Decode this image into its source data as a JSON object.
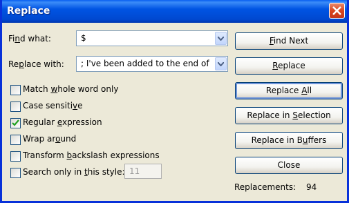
{
  "window": {
    "title": "Replace"
  },
  "find": {
    "label_pre": "Fi",
    "label_u": "n",
    "label_post": "d what:",
    "value": "$"
  },
  "replace": {
    "label_pre": "Re",
    "label_u": "p",
    "label_post": "lace with:",
    "value": "; I've been added to the end of every line"
  },
  "options": [
    {
      "pre": "Match ",
      "u": "w",
      "post": "hole word only",
      "checked": false
    },
    {
      "pre": "Case sensiti",
      "u": "v",
      "post": "e",
      "checked": false
    },
    {
      "pre": "Regular ",
      "u": "e",
      "post": "xpression",
      "checked": true
    },
    {
      "pre": "Wrap ar",
      "u": "o",
      "post": "und",
      "checked": false
    },
    {
      "pre": "Transform ",
      "u": "b",
      "post": "ackslash expressions",
      "checked": false
    },
    {
      "pre": "Search only in ",
      "u": "t",
      "post": "his style:",
      "checked": false
    }
  ],
  "style_value": "11",
  "buttons": {
    "find_next": {
      "pre": "",
      "u": "F",
      "post": "ind Next"
    },
    "replace": {
      "pre": "",
      "u": "R",
      "post": "eplace"
    },
    "replace_all": {
      "pre": "Replace ",
      "u": "A",
      "post": "ll"
    },
    "replace_sel": {
      "pre": "Replace in ",
      "u": "S",
      "post": "election"
    },
    "replace_buf": {
      "pre": "Replace in B",
      "u": "u",
      "post": "ffers"
    },
    "close": {
      "pre": "Close",
      "u": "",
      "post": ""
    }
  },
  "status": {
    "label": "Replacements:",
    "count": "94"
  }
}
